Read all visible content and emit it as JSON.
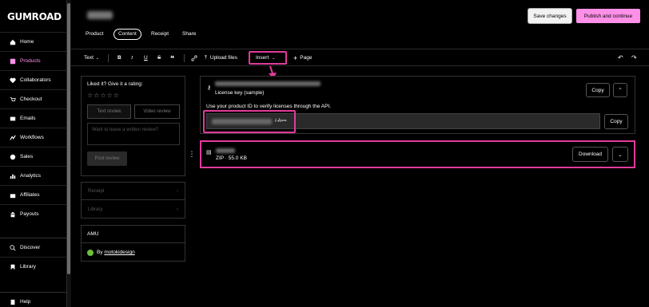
{
  "sidebar": {
    "logo": "GUMROAD",
    "items": [
      {
        "label": "Home",
        "icon": "home-icon",
        "active": false
      },
      {
        "label": "Products",
        "icon": "products-icon",
        "active": true
      },
      {
        "label": "Collaborators",
        "icon": "collaborators-icon",
        "active": false
      },
      {
        "label": "Checkout",
        "icon": "cart-icon",
        "active": false
      },
      {
        "label": "Emails",
        "icon": "envelope-icon",
        "active": false
      },
      {
        "label": "Workflows",
        "icon": "workflow-icon",
        "active": false
      },
      {
        "label": "Sales",
        "icon": "dollar-icon",
        "active": false
      },
      {
        "label": "Analytics",
        "icon": "bar-chart-icon",
        "active": false
      },
      {
        "label": "Affiliates",
        "icon": "gift-icon",
        "active": false
      },
      {
        "label": "Payouts",
        "icon": "bank-icon",
        "active": false
      },
      {
        "label": "Discover",
        "icon": "search-icon",
        "active": false
      },
      {
        "label": "Library",
        "icon": "bookmark-icon",
        "active": false
      },
      {
        "label": "Help",
        "icon": "book-icon",
        "active": false
      }
    ]
  },
  "header": {
    "tabs": [
      "Product",
      "Content",
      "Receipt",
      "Share"
    ],
    "active_tab": "Content",
    "save_label": "Save changes",
    "publish_label": "Publish and continue"
  },
  "toolbar": {
    "text_label": "Text",
    "upload_label": "Upload files",
    "insert_label": "Insert",
    "page_label": "Page"
  },
  "review": {
    "title": "Liked it? Give it a rating:",
    "stars": "☆☆☆☆☆",
    "text_tab": "Text review",
    "video_tab": "Video review",
    "placeholder": "Want to leave a written review?",
    "post_label": "Post review"
  },
  "accordion": {
    "receipt": "Receipt",
    "library": "Library"
  },
  "author_card": {
    "title": "AMU",
    "by": "By",
    "author": "motokidesign"
  },
  "license_card": {
    "label": "License key (sample)",
    "help": "Use your product ID to verify licenses through the API.",
    "key_suffix": "/-A==",
    "copy_label": "Copy",
    "field_copy_label": "Copy"
  },
  "file_card": {
    "meta": "ZIP · 55.0 KB",
    "download_label": "Download"
  },
  "colors": {
    "accent_pink": "#ff90e8",
    "highlight": "#e23b9b"
  }
}
